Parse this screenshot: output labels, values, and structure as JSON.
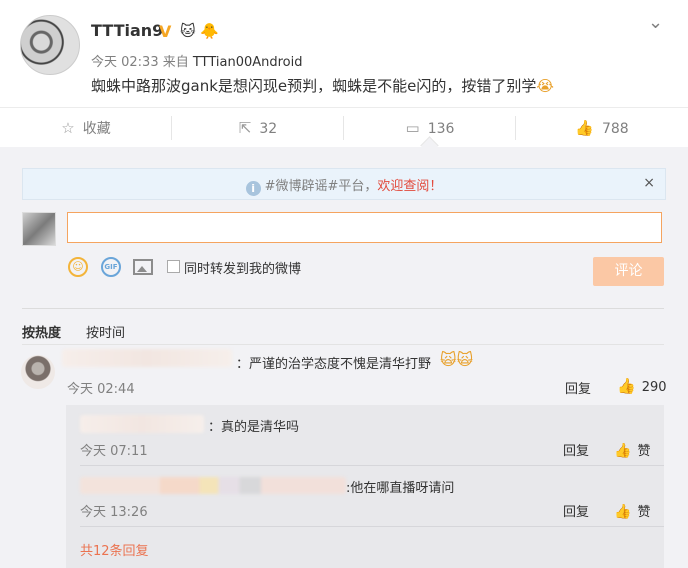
{
  "post": {
    "username": "TTTian9",
    "verified_badge": "V",
    "time": "今天 02:33",
    "source_prefix": "来自",
    "source": "TTTian00Android",
    "text": "蜘蛛中路那波gank是想闪现e预判，蜘蛛是不能e闪的，按错了别学",
    "text_emoji": "😭"
  },
  "actions": {
    "favorite": {
      "icon": "star-icon",
      "label": "收藏"
    },
    "repost": {
      "icon": "repost-icon",
      "count": "32"
    },
    "comment": {
      "icon": "comment-icon",
      "count": "136"
    },
    "like": {
      "icon": "thumb-up-icon",
      "count": "788"
    }
  },
  "notice": {
    "prefix": "#微博辟谣#平台，",
    "highlight": "欢迎查阅！",
    "close": "×"
  },
  "composer": {
    "input_value": "",
    "repost_label": "同时转发到我的微博",
    "submit_label": "评论",
    "gif_label": "GIF"
  },
  "sort": {
    "hot": "按热度",
    "time": "按时间"
  },
  "comments": [
    {
      "text": "：严谨的治学态度不愧是清华打野",
      "emoji": "🙀🙀",
      "time": "今天 02:44",
      "reply": "回复",
      "likes": "290",
      "replies": [
        {
          "text": "：真的是清华吗",
          "time": "今天 07:11",
          "reply": "回复",
          "like_label": "赞"
        },
        {
          "text": ":他在哪直播呀请问",
          "time": "今天 13:26",
          "reply": "回复",
          "like_label": "赞"
        }
      ],
      "more": "共12条回复"
    }
  ],
  "colors": {
    "accent_orange": "#eb7350",
    "input_border": "#f5a45f",
    "submit_disabled": "#fbc8a5",
    "notice_red": "#e24a3c"
  }
}
